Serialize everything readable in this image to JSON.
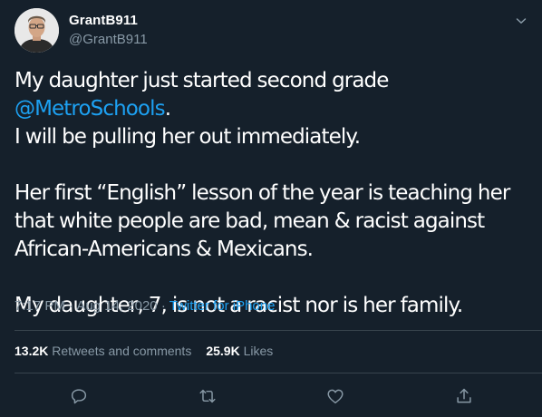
{
  "author": {
    "display_name": "GrantB911",
    "handle": "@GrantB911",
    "avatar_icon": "avatar-photo"
  },
  "tweet": {
    "line1_text": "My daughter just started second grade ",
    "mention": "@MetroSchools",
    "line1_end": ".",
    "line2": "I will be pulling her out immediately.",
    "paragraph2": "Her first “English” lesson of the year is teaching her that white people are bad, mean & racist against African-Americans & Mexicans.",
    "paragraph3": "My daughter, 7, is not a racist nor is her family."
  },
  "meta": {
    "time": "7:17 PM",
    "separator": "·",
    "date": "Aug 14, 2020",
    "source": "Twitter for iPhone"
  },
  "stats": {
    "retweets_count": "13.2K",
    "retweets_label": "Retweets and comments",
    "likes_count": "25.9K",
    "likes_label": "Likes"
  },
  "actions": {
    "reply_icon": "comment-icon",
    "retweet_icon": "retweet-icon",
    "like_icon": "heart-icon",
    "share_icon": "share-icon"
  },
  "colors": {
    "background": "#15202b",
    "text": "#ffffff",
    "secondary": "#8899a6",
    "accent": "#1da1f2",
    "divider": "#38444d"
  }
}
